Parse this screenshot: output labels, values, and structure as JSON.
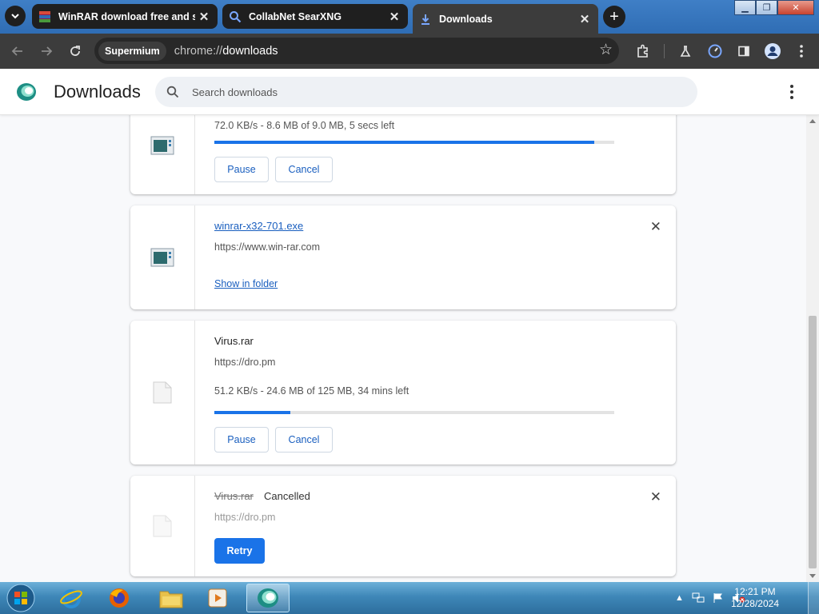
{
  "browser": {
    "tabs": [
      {
        "title": "WinRAR download free and su",
        "favicon": "winrar-icon"
      },
      {
        "title": "CollabNet SearXNG",
        "favicon": "search-icon"
      },
      {
        "title": "Downloads",
        "favicon": "download-icon"
      }
    ],
    "site_chip": "Supermium",
    "url_scheme": "chrome://",
    "url_host": "downloads"
  },
  "page": {
    "title": "Downloads",
    "search_placeholder": "Search downloads"
  },
  "downloads": [
    {
      "progress_text": "72.0 KB/s - 8.6 MB of 9.0 MB, 5 secs left",
      "progress_fraction": 0.95,
      "pause_label": "Pause",
      "cancel_label": "Cancel"
    },
    {
      "filename": "winrar-x32-701.exe",
      "url": "https://www.win-rar.com",
      "show_in_folder": "Show in folder"
    },
    {
      "filename": "Virus.rar",
      "url": "https://dro.pm",
      "progress_text": "51.2 KB/s - 24.6 MB of 125 MB, 34 mins left",
      "progress_fraction": 0.19,
      "pause_label": "Pause",
      "cancel_label": "Cancel"
    },
    {
      "filename": "Virus.rar",
      "status": "Cancelled",
      "url": "https://dro.pm",
      "retry_label": "Retry"
    }
  ],
  "taskbar": {
    "apps": [
      "internet-explorer-icon",
      "firefox-icon",
      "file-explorer-icon",
      "media-player-icon",
      "supermium-icon"
    ],
    "time": "12:21 PM",
    "date": "12/28/2024"
  },
  "colors": {
    "accent": "#1a73e8",
    "link": "#1a5fbf",
    "toolbar": "#3c3c3c",
    "tabstrip": "#3f7fc6"
  }
}
